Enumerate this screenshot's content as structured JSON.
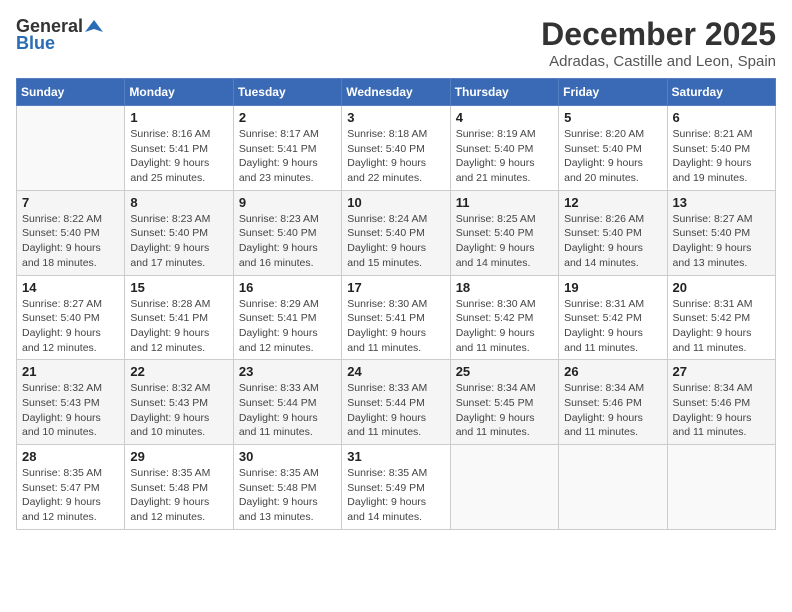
{
  "header": {
    "logo_general": "General",
    "logo_blue": "Blue",
    "month_title": "December 2025",
    "subtitle": "Adradas, Castille and Leon, Spain"
  },
  "days_of_week": [
    "Sunday",
    "Monday",
    "Tuesday",
    "Wednesday",
    "Thursday",
    "Friday",
    "Saturday"
  ],
  "weeks": [
    [
      {
        "day": "",
        "info": ""
      },
      {
        "day": "1",
        "info": "Sunrise: 8:16 AM\nSunset: 5:41 PM\nDaylight: 9 hours\nand 25 minutes."
      },
      {
        "day": "2",
        "info": "Sunrise: 8:17 AM\nSunset: 5:41 PM\nDaylight: 9 hours\nand 23 minutes."
      },
      {
        "day": "3",
        "info": "Sunrise: 8:18 AM\nSunset: 5:40 PM\nDaylight: 9 hours\nand 22 minutes."
      },
      {
        "day": "4",
        "info": "Sunrise: 8:19 AM\nSunset: 5:40 PM\nDaylight: 9 hours\nand 21 minutes."
      },
      {
        "day": "5",
        "info": "Sunrise: 8:20 AM\nSunset: 5:40 PM\nDaylight: 9 hours\nand 20 minutes."
      },
      {
        "day": "6",
        "info": "Sunrise: 8:21 AM\nSunset: 5:40 PM\nDaylight: 9 hours\nand 19 minutes."
      }
    ],
    [
      {
        "day": "7",
        "info": "Sunrise: 8:22 AM\nSunset: 5:40 PM\nDaylight: 9 hours\nand 18 minutes."
      },
      {
        "day": "8",
        "info": "Sunrise: 8:23 AM\nSunset: 5:40 PM\nDaylight: 9 hours\nand 17 minutes."
      },
      {
        "day": "9",
        "info": "Sunrise: 8:23 AM\nSunset: 5:40 PM\nDaylight: 9 hours\nand 16 minutes."
      },
      {
        "day": "10",
        "info": "Sunrise: 8:24 AM\nSunset: 5:40 PM\nDaylight: 9 hours\nand 15 minutes."
      },
      {
        "day": "11",
        "info": "Sunrise: 8:25 AM\nSunset: 5:40 PM\nDaylight: 9 hours\nand 14 minutes."
      },
      {
        "day": "12",
        "info": "Sunrise: 8:26 AM\nSunset: 5:40 PM\nDaylight: 9 hours\nand 14 minutes."
      },
      {
        "day": "13",
        "info": "Sunrise: 8:27 AM\nSunset: 5:40 PM\nDaylight: 9 hours\nand 13 minutes."
      }
    ],
    [
      {
        "day": "14",
        "info": "Sunrise: 8:27 AM\nSunset: 5:40 PM\nDaylight: 9 hours\nand 12 minutes."
      },
      {
        "day": "15",
        "info": "Sunrise: 8:28 AM\nSunset: 5:41 PM\nDaylight: 9 hours\nand 12 minutes."
      },
      {
        "day": "16",
        "info": "Sunrise: 8:29 AM\nSunset: 5:41 PM\nDaylight: 9 hours\nand 12 minutes."
      },
      {
        "day": "17",
        "info": "Sunrise: 8:30 AM\nSunset: 5:41 PM\nDaylight: 9 hours\nand 11 minutes."
      },
      {
        "day": "18",
        "info": "Sunrise: 8:30 AM\nSunset: 5:42 PM\nDaylight: 9 hours\nand 11 minutes."
      },
      {
        "day": "19",
        "info": "Sunrise: 8:31 AM\nSunset: 5:42 PM\nDaylight: 9 hours\nand 11 minutes."
      },
      {
        "day": "20",
        "info": "Sunrise: 8:31 AM\nSunset: 5:42 PM\nDaylight: 9 hours\nand 11 minutes."
      }
    ],
    [
      {
        "day": "21",
        "info": "Sunrise: 8:32 AM\nSunset: 5:43 PM\nDaylight: 9 hours\nand 10 minutes."
      },
      {
        "day": "22",
        "info": "Sunrise: 8:32 AM\nSunset: 5:43 PM\nDaylight: 9 hours\nand 10 minutes."
      },
      {
        "day": "23",
        "info": "Sunrise: 8:33 AM\nSunset: 5:44 PM\nDaylight: 9 hours\nand 11 minutes."
      },
      {
        "day": "24",
        "info": "Sunrise: 8:33 AM\nSunset: 5:44 PM\nDaylight: 9 hours\nand 11 minutes."
      },
      {
        "day": "25",
        "info": "Sunrise: 8:34 AM\nSunset: 5:45 PM\nDaylight: 9 hours\nand 11 minutes."
      },
      {
        "day": "26",
        "info": "Sunrise: 8:34 AM\nSunset: 5:46 PM\nDaylight: 9 hours\nand 11 minutes."
      },
      {
        "day": "27",
        "info": "Sunrise: 8:34 AM\nSunset: 5:46 PM\nDaylight: 9 hours\nand 11 minutes."
      }
    ],
    [
      {
        "day": "28",
        "info": "Sunrise: 8:35 AM\nSunset: 5:47 PM\nDaylight: 9 hours\nand 12 minutes."
      },
      {
        "day": "29",
        "info": "Sunrise: 8:35 AM\nSunset: 5:48 PM\nDaylight: 9 hours\nand 12 minutes."
      },
      {
        "day": "30",
        "info": "Sunrise: 8:35 AM\nSunset: 5:48 PM\nDaylight: 9 hours\nand 13 minutes."
      },
      {
        "day": "31",
        "info": "Sunrise: 8:35 AM\nSunset: 5:49 PM\nDaylight: 9 hours\nand 14 minutes."
      },
      {
        "day": "",
        "info": ""
      },
      {
        "day": "",
        "info": ""
      },
      {
        "day": "",
        "info": ""
      }
    ]
  ]
}
